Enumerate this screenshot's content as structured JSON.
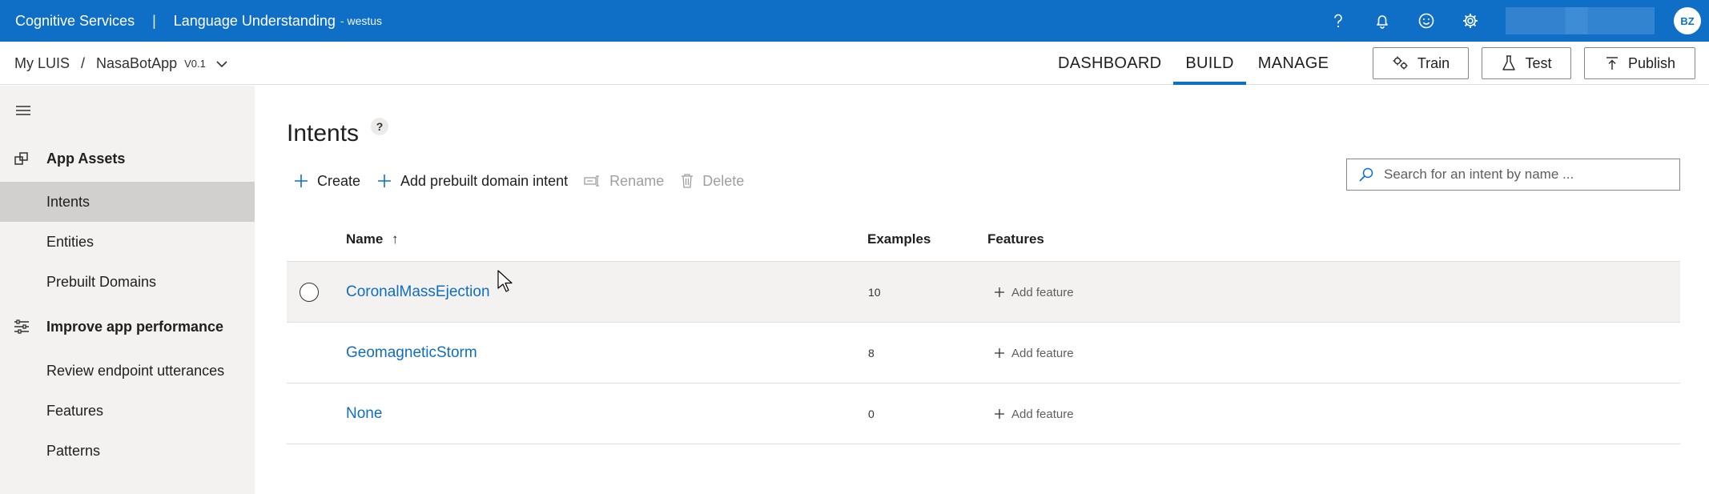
{
  "topbar": {
    "brand": "Cognitive Services",
    "separator": "|",
    "app_name": "Language Understanding",
    "region": "- westus",
    "avatar_initials": "BZ",
    "accent_color": "#0f6fc6"
  },
  "subbar": {
    "breadcrumb_root": "My LUIS",
    "breadcrumb_sep": "/",
    "app": "NasaBotApp",
    "version": "V0.1",
    "tabs": [
      {
        "label": "DASHBOARD"
      },
      {
        "label": "BUILD",
        "active": true
      },
      {
        "label": "MANAGE"
      }
    ],
    "train_label": "Train",
    "test_label": "Test",
    "publish_label": "Publish"
  },
  "sidebar": {
    "section_assets": "App Assets",
    "items_assets": [
      {
        "label": "Intents",
        "active": true
      },
      {
        "label": "Entities"
      },
      {
        "label": "Prebuilt Domains"
      }
    ],
    "section_perf": "Improve app performance",
    "items_perf": [
      {
        "label": "Review endpoint utterances"
      },
      {
        "label": "Features"
      },
      {
        "label": "Patterns"
      }
    ]
  },
  "main": {
    "title": "Intents",
    "help": "?",
    "toolbar": {
      "create": "Create",
      "add_prebuilt": "Add prebuilt domain intent",
      "rename": "Rename",
      "delete": "Delete"
    },
    "search_placeholder": "Search for an intent by name ...",
    "columns": {
      "name": "Name",
      "sort_arrow": "↑",
      "examples": "Examples",
      "features": "Features"
    },
    "rows": [
      {
        "name": "CoronalMassEjection",
        "examples": "10",
        "feature": "Add feature"
      },
      {
        "name": "GeomagneticStorm",
        "examples": "8",
        "feature": "Add feature"
      },
      {
        "name": "None",
        "examples": "0",
        "feature": "Add feature"
      }
    ]
  }
}
